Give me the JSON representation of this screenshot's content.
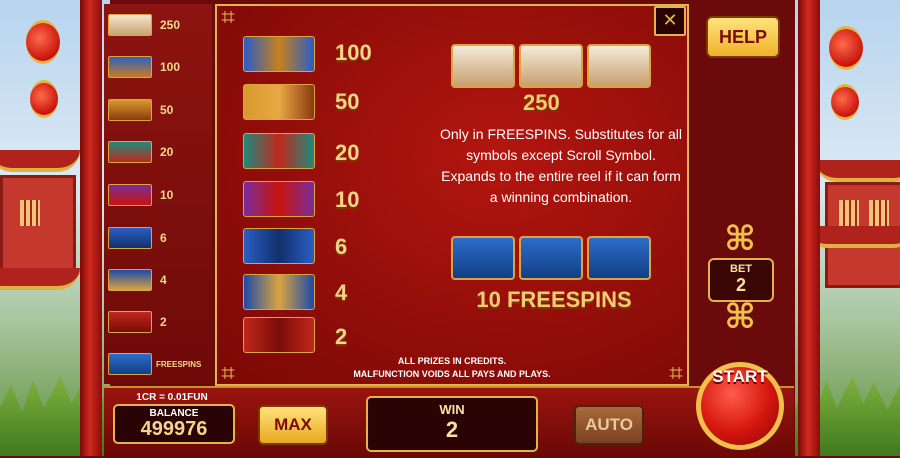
{
  "left_paytable": [
    {
      "symbol": "cat-symbol",
      "value": "250"
    },
    {
      "symbol": "dragon-symbol",
      "value": "100"
    },
    {
      "symbol": "teapot-symbol",
      "value": "50"
    },
    {
      "symbol": "money-bag-symbol",
      "value": "20"
    },
    {
      "symbol": "lantern-symbol",
      "value": "10"
    },
    {
      "symbol": "yin-yang-symbol",
      "value": "6"
    },
    {
      "symbol": "blue-coin-symbol",
      "value": "4"
    },
    {
      "symbol": "red-coin-symbol",
      "value": "2"
    },
    {
      "symbol": "scroll-symbol",
      "value": "FREESPINS"
    }
  ],
  "main_paytable": [
    {
      "symbol": "dragon-symbol",
      "value": "100"
    },
    {
      "symbol": "teapot-symbol",
      "value": "50"
    },
    {
      "symbol": "money-bag-symbol",
      "value": "20"
    },
    {
      "symbol": "lantern-symbol",
      "value": "10"
    },
    {
      "symbol": "yin-yang-symbol",
      "value": "6"
    },
    {
      "symbol": "blue-coin-symbol",
      "value": "4"
    },
    {
      "symbol": "red-coin-symbol",
      "value": "2"
    }
  ],
  "wild": {
    "value": "250",
    "description": "Only in FREESPINS. Substitutes for all symbols except Scroll Symbol. Expands to the entire reel if it can form a winning combination."
  },
  "scatter": {
    "value": "10 FREESPINS"
  },
  "footer": {
    "line1": "ALL PRIZES IN CREDITS.",
    "line2": "MALFUNCTION VOIDS ALL PAYS AND PLAYS."
  },
  "close_label": "✕",
  "help_label": "HELP",
  "bet": {
    "label": "BET",
    "value": "2"
  },
  "rate": "1CR = 0.01FUN",
  "balance": {
    "label": "BALANCE",
    "value": "499976"
  },
  "max_label": "MAX",
  "win": {
    "label": "WIN",
    "value": "2"
  },
  "auto_label": "AUTO",
  "start_label": "START",
  "colors": {
    "accent": "#e2b54c",
    "panel": "#8a0c08",
    "gold_text": "#f5d489"
  }
}
